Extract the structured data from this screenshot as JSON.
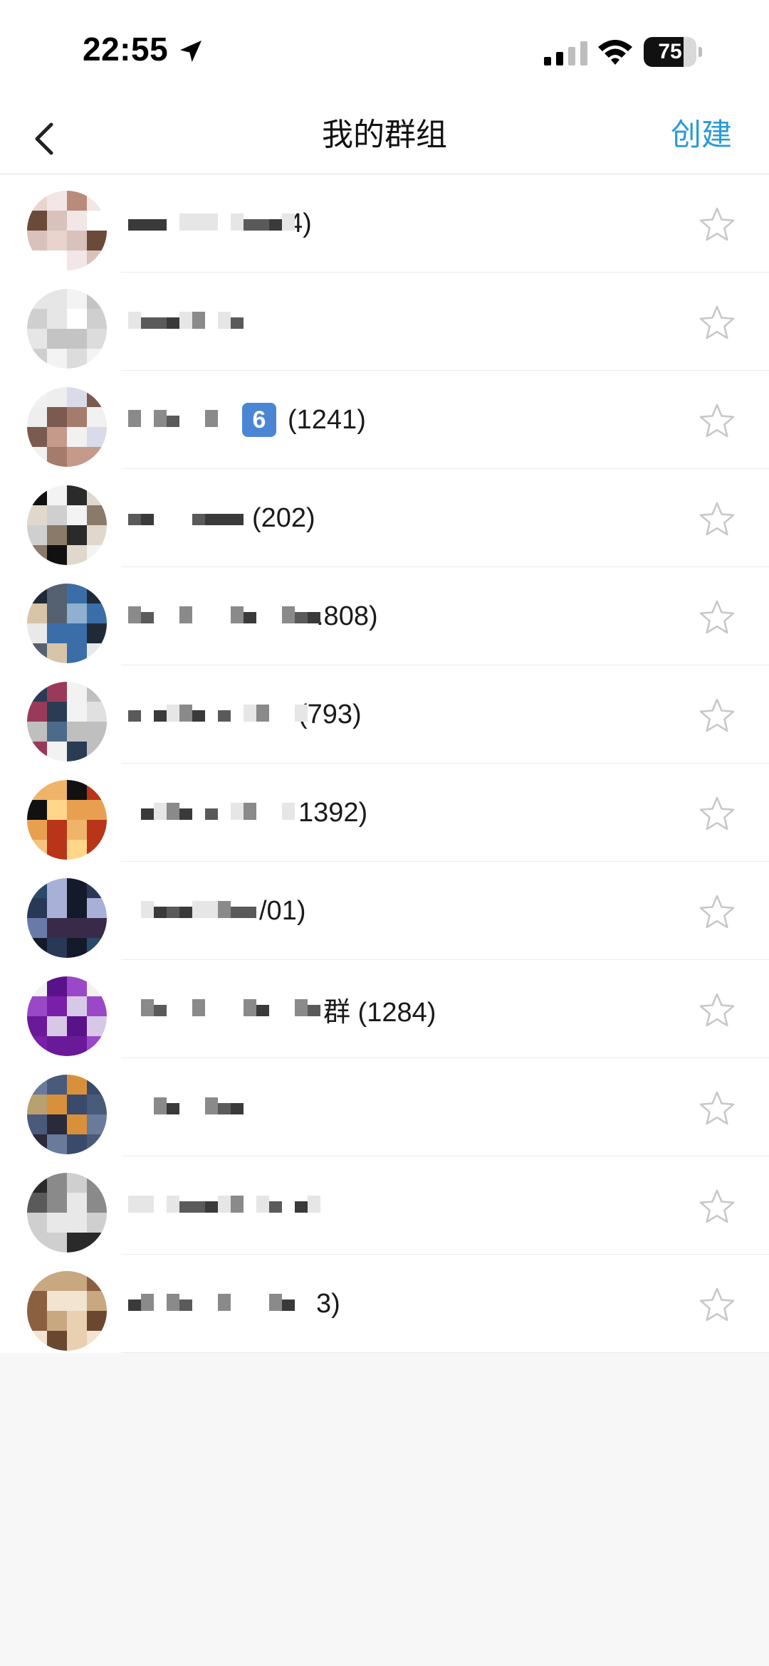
{
  "status_bar": {
    "time": "22:55",
    "battery": "75",
    "battery_level": 0.75,
    "icons": [
      "location-arrow-icon",
      "signal-icon",
      "wifi-icon",
      "battery-icon"
    ]
  },
  "nav": {
    "title": "我的群组",
    "action": "创建",
    "back_icon": "chevron-left-icon"
  },
  "colors": {
    "accent": "#2a9ad8",
    "star": "#c8c8c8",
    "background": "#f7f7f7"
  },
  "groups": [
    {
      "visible_text": "4)",
      "starred": false
    },
    {
      "visible_text": "",
      "starred": false
    },
    {
      "visible_text": "(1241)",
      "badge": "6",
      "starred": false
    },
    {
      "visible_text": "(202)",
      "starred": false
    },
    {
      "visible_text": ".808)",
      "starred": false
    },
    {
      "visible_text": "(793)",
      "starred": false
    },
    {
      "visible_text": "1392)",
      "starred": false
    },
    {
      "visible_text": "/01)",
      "starred": false
    },
    {
      "visible_text": "群 (1284)",
      "starred": false
    },
    {
      "visible_text": "",
      "starred": false
    },
    {
      "visible_text": "",
      "starred": false
    },
    {
      "visible_text": "3)",
      "starred": false
    }
  ]
}
